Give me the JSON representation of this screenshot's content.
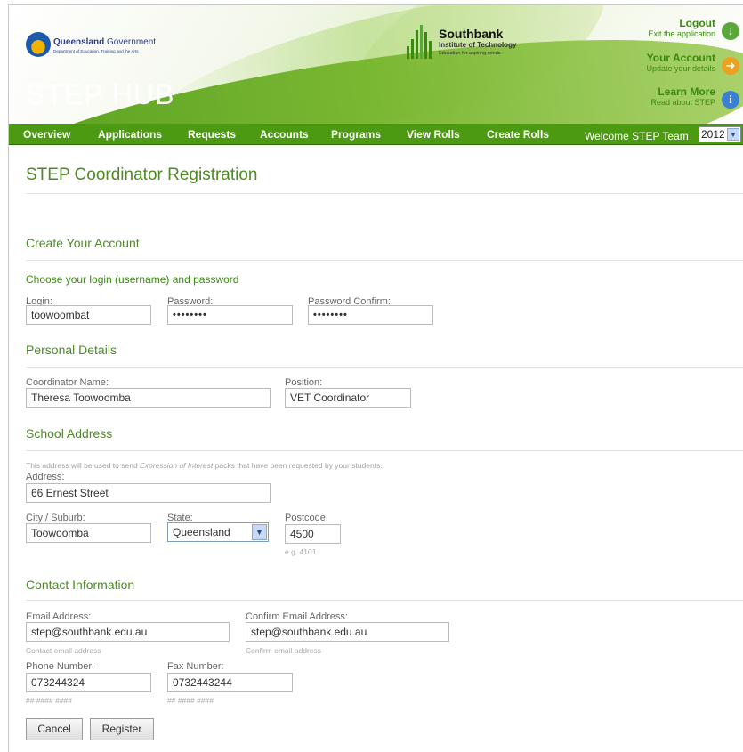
{
  "header": {
    "gov_name_bold": "Queensland",
    "gov_name": "Government",
    "gov_dept": "Department of Education, Training and the Arts",
    "app_title": "STEP HUB",
    "institute_name": "Southbank",
    "institute_full": "Institute of Technology",
    "institute_tagline": "Education for aspiring minds",
    "links": [
      {
        "title": "Logout",
        "subtitle": "Exit the application",
        "icon": "arrow-down-icon",
        "color": "#5aa83a"
      },
      {
        "title": "Your Account",
        "subtitle": "Update your details",
        "icon": "arrow-right-icon",
        "color": "#f0a020"
      },
      {
        "title": "Learn More",
        "subtitle": "Read about STEP",
        "icon": "info-icon",
        "color": "#3a7fd0"
      }
    ]
  },
  "nav": {
    "items": [
      "Overview",
      "Applications",
      "Requests",
      "Accounts",
      "Programs",
      "View Rolls",
      "Create Rolls"
    ],
    "welcome": "Welcome STEP Team",
    "year": "2012"
  },
  "page": {
    "title": "STEP Coordinator Registration"
  },
  "account": {
    "heading": "Create Your Account",
    "subheading": "Choose your login (username) and password",
    "login_label": "Login:",
    "login_value": "toowoombat",
    "password_label": "Password:",
    "password_value": "••••••••",
    "confirm_label": "Password Confirm:",
    "confirm_value": "••••••••"
  },
  "personal": {
    "heading": "Personal Details",
    "name_label": "Coordinator Name:",
    "name_value": "Theresa Toowoomba",
    "position_label": "Position:",
    "position_value": "VET Coordinator"
  },
  "address": {
    "heading": "School Address",
    "note_before": "This address will be used to send ",
    "note_em": "Expression of Interest",
    "note_after": " packs that have been requested by your students.",
    "address_label": "Address:",
    "address_value": "66 Ernest Street",
    "city_label": "City / Suburb:",
    "city_value": "Toowoomba",
    "state_label": "State:",
    "state_value": "Queensland",
    "postcode_label": "Postcode:",
    "postcode_value": "4500",
    "postcode_hint": "e.g. 4101"
  },
  "contact": {
    "heading": "Contact Information",
    "email_label": "Email Address:",
    "email_value": "step@southbank.edu.au",
    "email_hint": "Contact email address",
    "confirm_email_label": "Confirm Email Address:",
    "confirm_email_value": "step@southbank.edu.au",
    "confirm_email_hint": "Confirm email address",
    "phone_label": "Phone Number:",
    "phone_value": "073244324",
    "phone_hint": "## #### ####",
    "fax_label": "Fax Number:",
    "fax_value": "0732443244",
    "fax_hint": "## #### ####"
  },
  "actions": {
    "cancel": "Cancel",
    "register": "Register"
  }
}
